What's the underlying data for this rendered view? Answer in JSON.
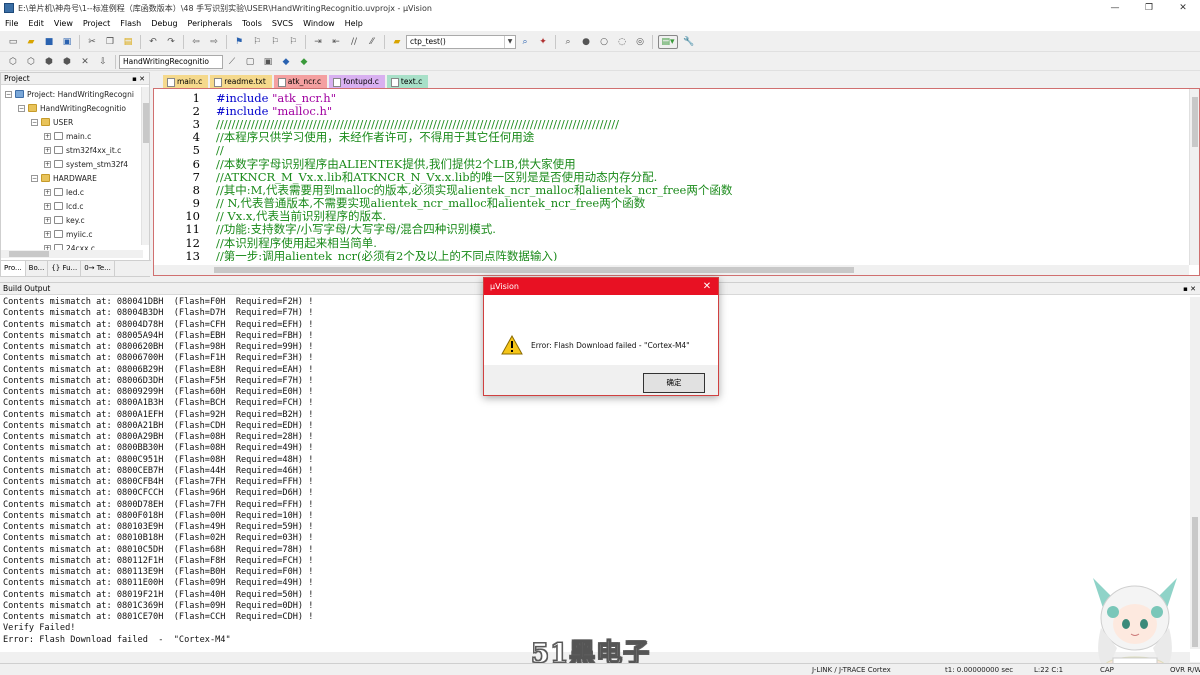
{
  "window": {
    "title": "E:\\单片机\\神舟号\\1--标准例程（库函数版本）\\48 手写识别实验\\USER\\HandWritingRecognitio.uvprojx - µVision",
    "controls": [
      "—",
      "❐",
      "✕"
    ]
  },
  "menu": [
    "File",
    "Edit",
    "View",
    "Project",
    "Flash",
    "Debug",
    "Peripherals",
    "Tools",
    "SVCS",
    "Window",
    "Help"
  ],
  "toolbar": {
    "find_combo": "ctp_test()",
    "target_combo": "HandWritingRecognitio"
  },
  "project_panel": {
    "title": "Project",
    "tree": [
      {
        "level": 0,
        "expander": "−",
        "icon": "proj",
        "label": "Project: HandWritingRecogni"
      },
      {
        "level": 1,
        "expander": "−",
        "icon": "folder",
        "label": "HandWritingRecognitio"
      },
      {
        "level": 2,
        "expander": "−",
        "icon": "folder",
        "label": "USER"
      },
      {
        "level": 3,
        "expander": "+",
        "icon": "file",
        "label": "main.c"
      },
      {
        "level": 3,
        "expander": "+",
        "icon": "file",
        "label": "stm32f4xx_it.c"
      },
      {
        "level": 3,
        "expander": "+",
        "icon": "file",
        "label": "system_stm32f4"
      },
      {
        "level": 2,
        "expander": "−",
        "icon": "folder",
        "label": "HARDWARE"
      },
      {
        "level": 3,
        "expander": "+",
        "icon": "file",
        "label": "led.c"
      },
      {
        "level": 3,
        "expander": "+",
        "icon": "file",
        "label": "lcd.c"
      },
      {
        "level": 3,
        "expander": "+",
        "icon": "file",
        "label": "key.c"
      },
      {
        "level": 3,
        "expander": "+",
        "icon": "file",
        "label": "myiic.c"
      },
      {
        "level": 3,
        "expander": "+",
        "icon": "file",
        "label": "24cxx.c"
      }
    ],
    "tabs": [
      "Pro...",
      "Bo...",
      "{} Fu...",
      "0→ Te..."
    ]
  },
  "editor": {
    "tabs": [
      {
        "label": "main.c",
        "color": "#f5d98c"
      },
      {
        "label": "readme.txt",
        "color": "#f5d98c"
      },
      {
        "label": "atk_ncr.c",
        "color": "#f4a0a0"
      },
      {
        "label": "fontupd.c",
        "color": "#d8b0f0"
      },
      {
        "label": "text.c",
        "color": "#a8e0c8"
      }
    ],
    "lines": [
      {
        "n": "1",
        "t": "#include \"atk_ncr.h\"",
        "style": "include"
      },
      {
        "n": "2",
        "t": "#include \"malloc.h\"",
        "style": "include"
      },
      {
        "n": "3",
        "t": "////////////////////////////////////////////////////////////////////////////////////////////////////////",
        "style": "cmt"
      },
      {
        "n": "4",
        "t": "//本程序只供学习使用，未经作者许可，不得用于其它任何用途",
        "style": "cmt"
      },
      {
        "n": "5",
        "t": "//",
        "style": "cmt"
      },
      {
        "n": "6",
        "t": "//本数字字母识别程序由ALIENTEK提供,我们提供2个LIB,供大家使用",
        "style": "cmt"
      },
      {
        "n": "7",
        "t": "//ATKNCR_M_Vx.x.lib和ATKNCR_N_Vx.x.lib的唯一区别是是否使用动态内存分配.",
        "style": "cmt"
      },
      {
        "n": "8",
        "t": "//其中:M,代表需要用到malloc的版本,必须实现alientek_ncr_malloc和alientek_ncr_free两个函数",
        "style": "cmt"
      },
      {
        "n": "9",
        "t": "//     N,代表普通版本,不需要实现alientek_ncr_malloc和alientek_ncr_free两个函数",
        "style": "cmt"
      },
      {
        "n": "10",
        "t": "//     Vx.x,代表当前识别程序的版本.",
        "style": "cmt"
      },
      {
        "n": "11",
        "t": "//功能:支持数字/小写字母/大写字母/混合四种识别模式.",
        "style": "cmt"
      },
      {
        "n": "12",
        "t": "//本识别程序使用起来相当简单.",
        "style": "cmt"
      },
      {
        "n": "13",
        "t": "//第一步:调用alientek_ncr(必须有2个及以上的不同点阵数据输入)",
        "style": "cmt"
      }
    ]
  },
  "build_output": {
    "title": "Build Output",
    "lines": [
      "Contents mismatch at: 080041DBH  (Flash=F0H  Required=F2H) !",
      "Contents mismatch at: 08004B3DH  (Flash=D7H  Required=F7H) !",
      "Contents mismatch at: 08004D78H  (Flash=CFH  Required=EFH) !",
      "Contents mismatch at: 08005A94H  (Flash=EBH  Required=FBH) !",
      "Contents mismatch at: 0800620BH  (Flash=98H  Required=99H) !",
      "Contents mismatch at: 08006700H  (Flash=F1H  Required=F3H) !",
      "Contents mismatch at: 08006B29H  (Flash=E8H  Required=EAH) !",
      "Contents mismatch at: 08006D3DH  (Flash=F5H  Required=F7H) !",
      "Contents mismatch at: 08009299H  (Flash=60H  Required=E0H) !",
      "Contents mismatch at: 0800A1B3H  (Flash=BCH  Required=FCH) !",
      "Contents mismatch at: 0800A1EFH  (Flash=92H  Required=B2H) !",
      "Contents mismatch at: 0800A21BH  (Flash=CDH  Required=EDH) !",
      "Contents mismatch at: 0800A29BH  (Flash=08H  Required=28H) !",
      "Contents mismatch at: 0800BB30H  (Flash=08H  Required=49H) !",
      "Contents mismatch at: 0800C951H  (Flash=08H  Required=48H) !",
      "Contents mismatch at: 0800CEB7H  (Flash=44H  Required=46H) !",
      "Contents mismatch at: 0800CFB4H  (Flash=7FH  Required=FFH) !",
      "Contents mismatch at: 0800CFCCH  (Flash=96H  Required=D6H) !",
      "Contents mismatch at: 0800D78EH  (Flash=7FH  Required=FFH) !",
      "Contents mismatch at: 0800F018H  (Flash=00H  Required=10H) !",
      "Contents mismatch at: 080103E9H  (Flash=49H  Required=59H) !",
      "Contents mismatch at: 08010B18H  (Flash=02H  Required=03H) !",
      "Contents mismatch at: 08010C5DH  (Flash=68H  Required=78H) !",
      "Contents mismatch at: 080112F1H  (Flash=F8H  Required=FCH) !",
      "Contents mismatch at: 080113E9H  (Flash=B0H  Required=F0H) !",
      "Contents mismatch at: 08011E00H  (Flash=09H  Required=49H) !",
      "Contents mismatch at: 08019F21H  (Flash=40H  Required=50H) !",
      "Contents mismatch at: 0801C369H  (Flash=09H  Required=0DH) !",
      "Contents mismatch at: 0801CE70H  (Flash=CCH  Required=CDH) !",
      "Verify Failed!",
      "Error: Flash Download failed  -  \"Cortex-M4\""
    ]
  },
  "dialog": {
    "title": "µVision",
    "close": "✕",
    "message": "Error: Flash Download failed  -  \"Cortex-M4\"",
    "ok_label": "确定"
  },
  "watermark": "51黑电子",
  "statusbar": {
    "debugger": "J-LINK / J-TRACE Cortex",
    "time": "t1: 0.00000000 sec",
    "position": "L:22 C:1",
    "mode": "OVR R/W",
    "cap": "CAP"
  }
}
